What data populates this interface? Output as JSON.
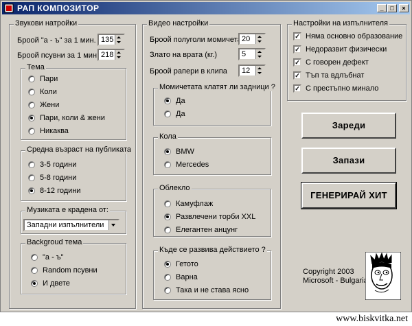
{
  "window": {
    "title": "РАП КОМПОЗИТОР",
    "min_label": "_",
    "max_label": "□",
    "close_label": "×"
  },
  "sound": {
    "group_label": "Звукови натройки",
    "row1_label": "Броой \"а - ъ\" за 1 мин.",
    "row1_value": "135",
    "row2_label": "Броой псувни за 1 мин.",
    "row2_value": "218"
  },
  "theme": {
    "group_label": "Тема",
    "options": [
      "Пари",
      "Коли",
      "Жени",
      "Пари, коли & жени",
      "Никаква"
    ],
    "selected": 3
  },
  "age": {
    "group_label": "Средна възраст на публиката",
    "options": [
      "3-5 години",
      "5-8 години",
      "8-12 години"
    ],
    "selected": 2
  },
  "stolen": {
    "group_label": "Музиката е крадена от:",
    "value": "Западни изпълнители"
  },
  "bgtheme": {
    "group_label": "Backgroud тема",
    "options": [
      "\"а - ъ\"",
      "Random псувни",
      "И двете"
    ],
    "selected": 2
  },
  "video": {
    "group_label": "Видео настройки",
    "row1_label": "Броой полуголи момичета",
    "row1_value": "20",
    "row2_label": "Злато на врата (кг.)",
    "row2_value": "5",
    "row3_label": "Броой рапери в клипа",
    "row3_value": "12"
  },
  "girls": {
    "group_label": "Момичетата клатят ли задници ?",
    "options": [
      "Да",
      "Да"
    ],
    "selected": 0
  },
  "car": {
    "group_label": "Кола",
    "options": [
      "BMW",
      "Mercedes"
    ],
    "selected": 0
  },
  "clothes": {
    "group_label": "Облекло",
    "options": [
      "Камуфлаж",
      "Развлечени торби XXL",
      "Елегантен анцунг"
    ],
    "selected": 1
  },
  "place": {
    "group_label": "Къде се развива действието ?",
    "options": [
      "Гетото",
      "Варна",
      "Така и не става ясно"
    ],
    "selected": 0
  },
  "performer": {
    "group_label": "Настройки на изпълнителя",
    "items": [
      "Няма основно образование",
      "Недоразвит физически",
      "С говорен дефект",
      "Тъп та вдлъбнат",
      "С престъпно минало"
    ],
    "checked": [
      true,
      true,
      true,
      true,
      true
    ]
  },
  "buttons": {
    "load": "Зареди",
    "save": "Запази",
    "generate": "ГЕНЕРИРАЙ ХИТ"
  },
  "copyright": {
    "line1": "Copyright 2003",
    "line2": "Microsoft - Bulgaria"
  },
  "watermark": "www.biskvitka.net"
}
